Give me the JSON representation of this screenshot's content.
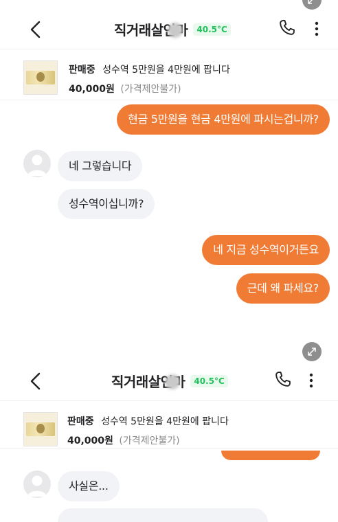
{
  "chat": {
    "partner_name": "직거래살인마",
    "temperature": "40.5°C"
  },
  "product": {
    "status": "판매중",
    "title": "성수역 5만원을 4만원에 팝니다",
    "price": "40,000원",
    "note": "(가격제안불가)"
  },
  "messages": [
    {
      "side": "out",
      "text": "현금 5만원을 현금 4만원에 파시는겁니까?"
    },
    {
      "side": "in",
      "text": "네 그렇습니다"
    },
    {
      "side": "in",
      "text": "성수역이십니까?"
    },
    {
      "side": "out",
      "text": "네 지금 성수역이거든요"
    },
    {
      "side": "out",
      "text": "근데 왜 파세요?"
    }
  ],
  "messages_2": [
    {
      "side": "in",
      "text": "사실은..."
    }
  ],
  "icons": {
    "back": "chevron-left-icon",
    "call": "phone-icon",
    "more": "kebab-menu-icon",
    "expand": "expand-icon",
    "avatar": "default-avatar-icon"
  },
  "colors": {
    "accent": "#f07b35",
    "incoming_bubble": "#f2f3f6",
    "temperature": "#20c25b"
  }
}
